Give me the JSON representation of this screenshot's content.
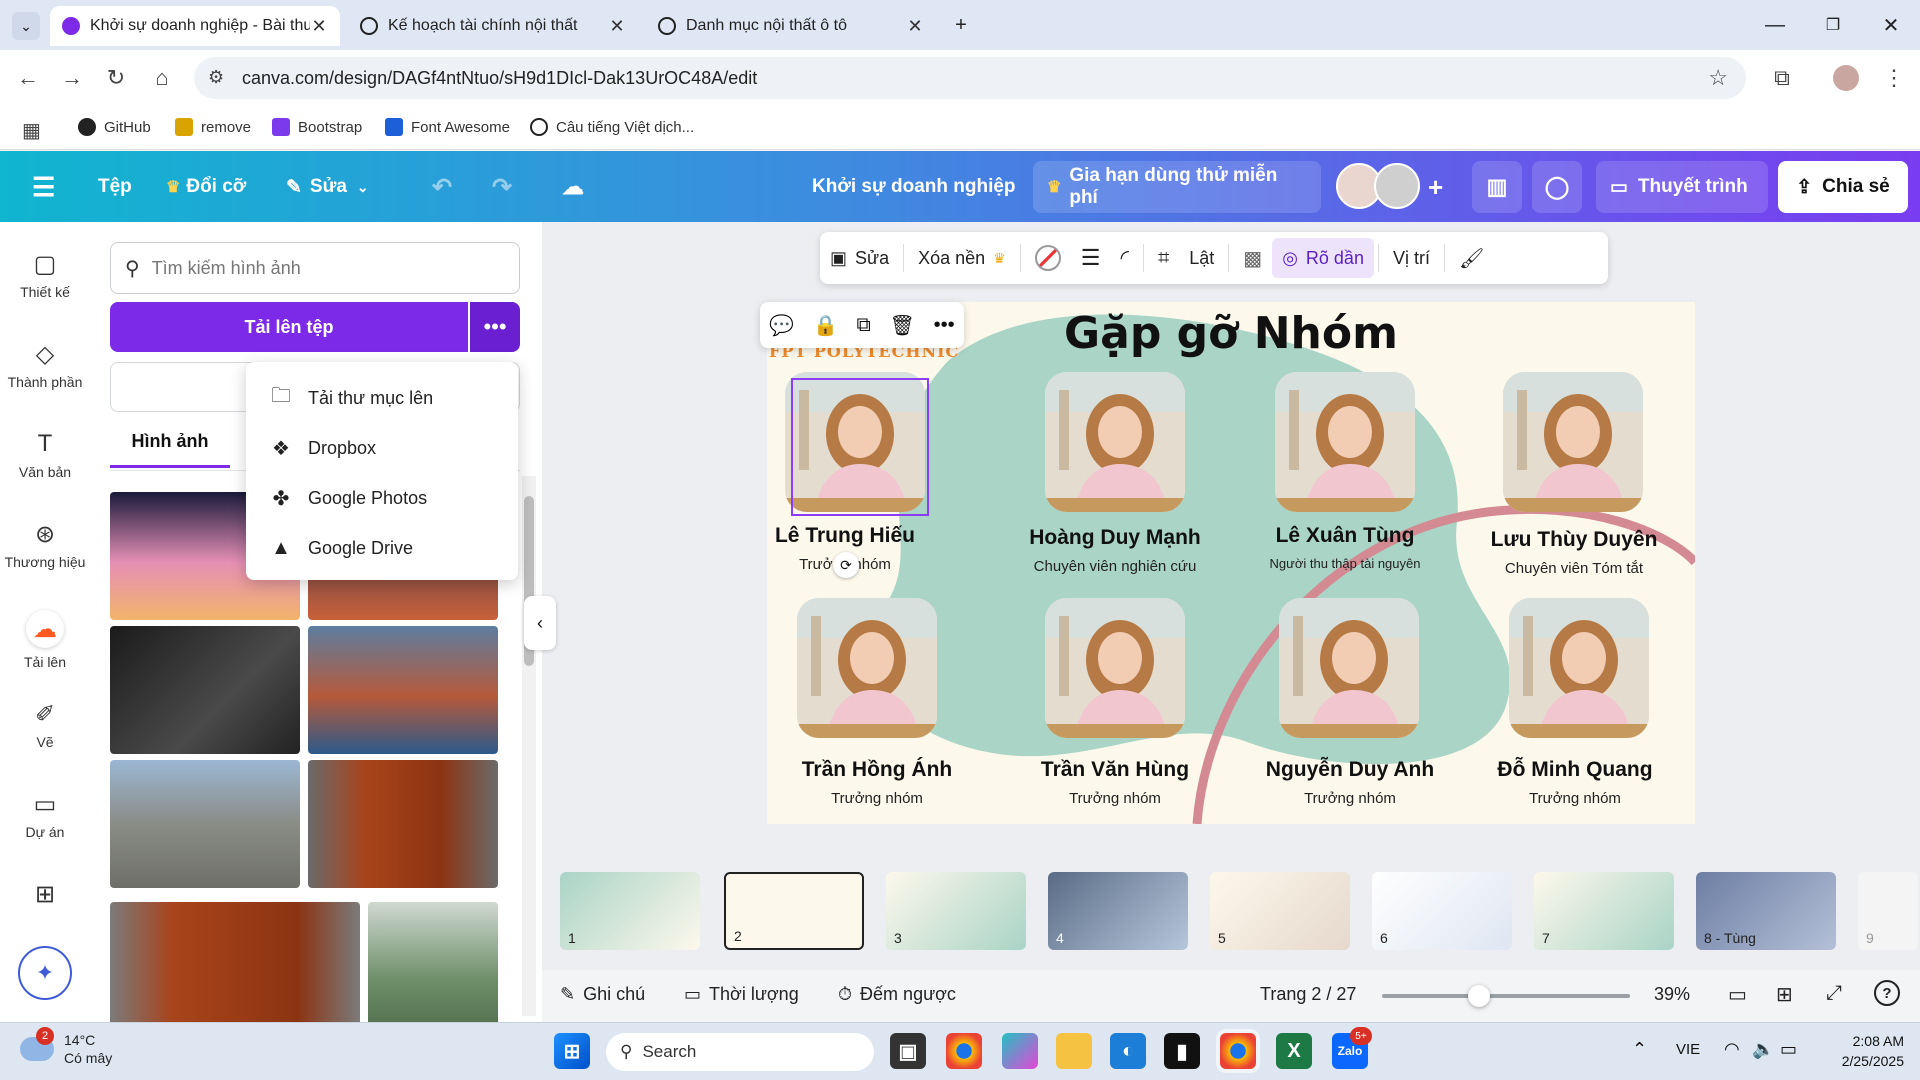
{
  "browser": {
    "tabs": [
      {
        "title": "Khởi sự doanh nghiệp - Bài thu",
        "active": true
      },
      {
        "title": "Kế hoạch tài chính nội thất",
        "active": false
      },
      {
        "title": "Danh mục nội thất ô tô",
        "active": false
      }
    ],
    "url": "canva.com/design/DAGf4ntNtuo/sH9d1DIcl-Dak13UrOC48A/edit",
    "bookmarks": [
      "GitHub",
      "remove",
      "Bootstrap",
      "Font Awesome",
      "Câu tiếng Việt dịch..."
    ]
  },
  "canva_header": {
    "file": "Tệp",
    "resize": "Đổi cỡ",
    "edit": "Sửa",
    "doc_title": "Khởi sự doanh nghiệp",
    "trial": "Gia hạn dùng thử miễn phí",
    "present": "Thuyết trình",
    "share": "Chia sẻ"
  },
  "rail": [
    {
      "label": "Thiết kế",
      "icon": "layout-icon"
    },
    {
      "label": "Thành phần",
      "icon": "elements-icon"
    },
    {
      "label": "Văn bản",
      "icon": "text-icon"
    },
    {
      "label": "Thương hiệu",
      "icon": "brand-icon"
    },
    {
      "label": "Tải lên",
      "icon": "upload-cloud-icon"
    },
    {
      "label": "Vẽ",
      "icon": "draw-icon"
    },
    {
      "label": "Dự án",
      "icon": "folder-icon"
    }
  ],
  "panel": {
    "search_placeholder": "Tìm kiếm hình ảnh",
    "upload_label": "Tải lên tệp",
    "tab_images": "Hình ảnh",
    "menu": [
      "Tải thư mục lên",
      "Dropbox",
      "Google Photos",
      "Google Drive"
    ]
  },
  "context_toolbar": {
    "edit": "Sửa",
    "remove_bg": "Xóa nền",
    "flip": "Lật",
    "fit": "Rõ dần",
    "position": "Vị trí"
  },
  "slide": {
    "brand": "FPT POLYTECHNIC",
    "title": "Gặp gỡ Nhóm",
    "members": [
      {
        "name": "Lê Trung Hiếu",
        "role": "Trưởng nhóm"
      },
      {
        "name": "Hoàng Duy Mạnh",
        "role": "Chuyên viên nghiên cứu"
      },
      {
        "name": "Lê Xuân Tùng",
        "role": "Người thu thập tài nguyên"
      },
      {
        "name": "Lưu Thùy Duyên",
        "role": "Chuyên viên Tóm tắt"
      },
      {
        "name": "Trần Hồng Ánh",
        "role": "Trưởng nhóm"
      },
      {
        "name": "Trần Văn Hùng",
        "role": "Trưởng nhóm"
      },
      {
        "name": "Nguyễn Duy Anh",
        "role": "Trưởng nhóm"
      },
      {
        "name": "Đỗ Minh Quang",
        "role": "Trưởng nhóm"
      }
    ]
  },
  "filmstrip": [
    "1",
    "2",
    "3",
    "4",
    "5",
    "6",
    "7",
    "8 - Tùng",
    "9"
  ],
  "bottom_bar": {
    "notes": "Ghi chú",
    "duration": "Thời lượng",
    "countdown": "Đếm ngược",
    "page": "Trang 2 / 27",
    "zoom": "39%",
    "zoom_fraction": 0.39
  },
  "taskbar": {
    "weather_temp": "14°C",
    "weather_desc": "Có mây",
    "weather_badge": "2",
    "search": "Search",
    "lang": "VIE",
    "time": "2:08 AM",
    "date": "2/25/2025",
    "zalo_badge": "5+"
  },
  "colors": {
    "canva_purple": "#7d2ae8",
    "slide_teal": "#a9d4c6",
    "accent_pink": "#d48a93"
  }
}
